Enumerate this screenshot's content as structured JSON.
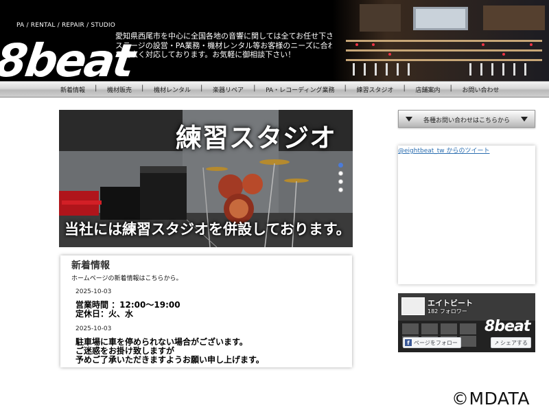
{
  "header": {
    "logo_text": "8beat",
    "tagline": "PA / RENTAL / REPAIR / STUDIO",
    "description_lines": [
      "愛知県西尾市を中心に全国各地の音響に関しては全てお任せ下さい。",
      "ステージの設営・PA業務・機材レンタル等お客様のニーズに合わせ",
      "て幅広く対応しております。お気軽に御相談下さい！"
    ]
  },
  "nav": {
    "items": [
      {
        "label": "新着情報"
      },
      {
        "label": "機材販売"
      },
      {
        "label": "機材レンタル"
      },
      {
        "label": "楽器リペア"
      },
      {
        "label": "PA・レコーディング業務"
      },
      {
        "label": "練習スタジオ"
      },
      {
        "label": "店舗案内"
      },
      {
        "label": "お問い合わせ"
      }
    ]
  },
  "hero": {
    "title": "練習スタジオ",
    "caption": "当社には練習スタジオを併設しております。",
    "slide_count": 4,
    "active_slide": 1
  },
  "news": {
    "title": "新着情報",
    "subtitle": "ホームページの新着情報はこちらから。",
    "entries": [
      {
        "date": "2025-10-03",
        "lines": [
          "営業時間 ：12:00〜19:00",
          "定休日：火、水"
        ]
      },
      {
        "date": "2025-10-03",
        "lines": [
          "駐車場に車を停められない場合がございます。",
          "ご迷惑をお掛け致しますが",
          "予めご了承いただきますようお願い申し上げます。"
        ]
      }
    ]
  },
  "sidebar": {
    "contact_label": "各種お問い合わせはこちらから",
    "tweets_link": "@eightbeat_tw からのツイート",
    "facebook": {
      "name": "エイトビート",
      "followers": "182 フォロワー",
      "follow_label": "ページをフォロー",
      "share_label": "シェアする",
      "logo_text": "8beat"
    }
  },
  "watermark": "©MDATA",
  "colors": {
    "header_bg": "#000000",
    "link": "#2a6db0",
    "slider_active": "#4b7bd9",
    "facebook_blue": "#3b5998"
  }
}
